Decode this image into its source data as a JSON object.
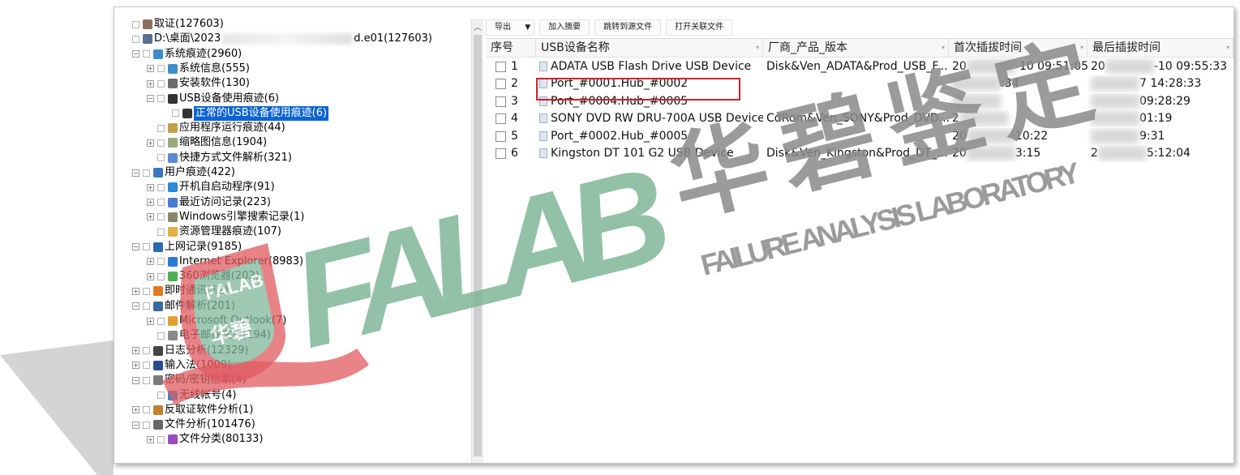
{
  "tree": [
    {
      "label": "取证(127603)",
      "prefix": "",
      "level": 0,
      "expander": "",
      "icon": "#8d6e5a"
    },
    {
      "label": "D:\\桌面\\2023",
      "suffix": "d.e01(127603)",
      "level": 0,
      "expander": "",
      "icon": "#5a6f90"
    },
    {
      "label": "系统痕迹(2960)",
      "level": 1,
      "expander": "−",
      "icon": "#3c8dcc"
    },
    {
      "label": "系统信息(555)",
      "level": 2,
      "expander": "+",
      "icon": "#3c8dcc"
    },
    {
      "label": "安装软件(130)",
      "level": 2,
      "expander": "+",
      "icon": "#6a6a6a"
    },
    {
      "label": "USB设备使用痕迹(6)",
      "level": 2,
      "expander": "−",
      "icon": "#333333"
    },
    {
      "label": "正常的USB设备使用痕迹(6)",
      "level": 3,
      "expander": "",
      "icon": "#333333",
      "selected": true
    },
    {
      "label": "应用程序运行痕迹(44)",
      "level": 2,
      "expander": "",
      "icon": "#c4a04a"
    },
    {
      "label": "缩略图信息(1904)",
      "level": 2,
      "expander": "+",
      "icon": "#9aa87c"
    },
    {
      "label": "快捷方式文件解析(321)",
      "level": 2,
      "expander": "",
      "icon": "#5a8ad0"
    },
    {
      "label": "用户痕迹(422)",
      "level": 1,
      "expander": "−",
      "icon": "#3a76c0"
    },
    {
      "label": "开机自启动程序(91)",
      "level": 2,
      "expander": "+",
      "icon": "#2a8ad8"
    },
    {
      "label": "最近访问记录(223)",
      "level": 2,
      "expander": "+",
      "icon": "#4a7ad0"
    },
    {
      "label": "Windows引擎搜索记录(1)",
      "level": 2,
      "expander": "+",
      "icon": "#8a8a6a"
    },
    {
      "label": "资源管理器痕迹(107)",
      "level": 2,
      "expander": "",
      "icon": "#e0b040"
    },
    {
      "label": "上网记录(9185)",
      "level": 1,
      "expander": "−",
      "icon": "#2a6ab0"
    },
    {
      "label": "Internet Explorer(8983)",
      "level": 2,
      "expander": "+",
      "icon": "#2a7ad8"
    },
    {
      "label": "360浏览器(202)",
      "level": 2,
      "expander": "+",
      "icon": "#4caf50"
    },
    {
      "label": "即时通讯(12)",
      "level": 1,
      "expander": "+",
      "icon": "#e07a20"
    },
    {
      "label": "邮件解析(201)",
      "level": 1,
      "expander": "−",
      "icon": "#3a6aa0"
    },
    {
      "label": "Microsoft Outlook(7)",
      "level": 2,
      "expander": "+",
      "icon": "#e0a030"
    },
    {
      "label": "电子邮件文件(194)",
      "level": 2,
      "expander": "",
      "icon": "#8a8a8a"
    },
    {
      "label": "日志分析(12329)",
      "level": 1,
      "expander": "+",
      "icon": "#444444"
    },
    {
      "label": "输入法(1009)",
      "level": 1,
      "expander": "+",
      "icon": "#2a4a90"
    },
    {
      "label": "密码/密钥检索(4)",
      "level": 1,
      "expander": "−",
      "icon": "#7a7a7a"
    },
    {
      "label": "无线帐号(4)",
      "level": 2,
      "expander": "",
      "icon": "#2a8ad8"
    },
    {
      "label": "反取证软件分析(1)",
      "level": 1,
      "expander": "+",
      "icon": "#c08030"
    },
    {
      "label": "文件分析(101476)",
      "level": 1,
      "expander": "−",
      "icon": "#666666"
    },
    {
      "label": "文件分类(80133)",
      "level": 2,
      "expander": "+",
      "icon": "#9a4ac0"
    }
  ],
  "toolbar": {
    "export": "导出",
    "add_summary": "加入摘要",
    "jump_source": "跳转到源文件",
    "open_related": "打开关联文件"
  },
  "table": {
    "headers": [
      "序号",
      "USB设备名称",
      "厂商_产品_版本",
      "首次插拔时间",
      "最后插拔时间"
    ],
    "rows": [
      {
        "no": "1",
        "name": "ADATA USB Flash Drive USB Device",
        "vendor": "Disk&Ven_ADATA&Prod_USB_F...",
        "first_a": "20",
        "first_b": "-10 09:51:05",
        "last_a": "20",
        "last_b": "-10 09:55:33"
      },
      {
        "no": "2",
        "name": "Port_#0001.Hub_#0002",
        "vendor": "",
        "first_a": "",
        "first_b": ":34",
        "last_a": "",
        "last_b": "7 14:28:33"
      },
      {
        "no": "3",
        "name": "Port_#0004.Hub_#0005",
        "vendor": "",
        "first_a": "",
        "first_b": "",
        "last_a": "",
        "last_b": "09:28:29"
      },
      {
        "no": "4",
        "name": "SONY DVD RW DRU-700A USB Device",
        "vendor": "CdRom&Ven_SONY&Prod_DVD...",
        "first_a": "2",
        "first_b": "",
        "last_a": "",
        "last_b": "01:19"
      },
      {
        "no": "5",
        "name": "Port_#0002.Hub_#0005",
        "vendor": "",
        "first_a": "20",
        "first_b": "10:22",
        "last_a": "",
        "last_b": "9:31"
      },
      {
        "no": "6",
        "name": "Kingston DT 101 G2 USB Device",
        "vendor": "Disk&Ven_Kingston&Prod_DT_...",
        "first_a": "20",
        "first_b": "3:15",
        "last_a": "2",
        "last_b": "5:12:04"
      }
    ]
  },
  "watermark": {
    "brand": "FALAB",
    "cn": "华碧鉴定",
    "en": "FAILURE ANALYSIS LABORATORY",
    "badge": "FALAB",
    "badge_cn": "华碧",
    "color_green": "#7fb79a",
    "color_gray": "#8a8a8a",
    "color_red": "#e05a60"
  }
}
